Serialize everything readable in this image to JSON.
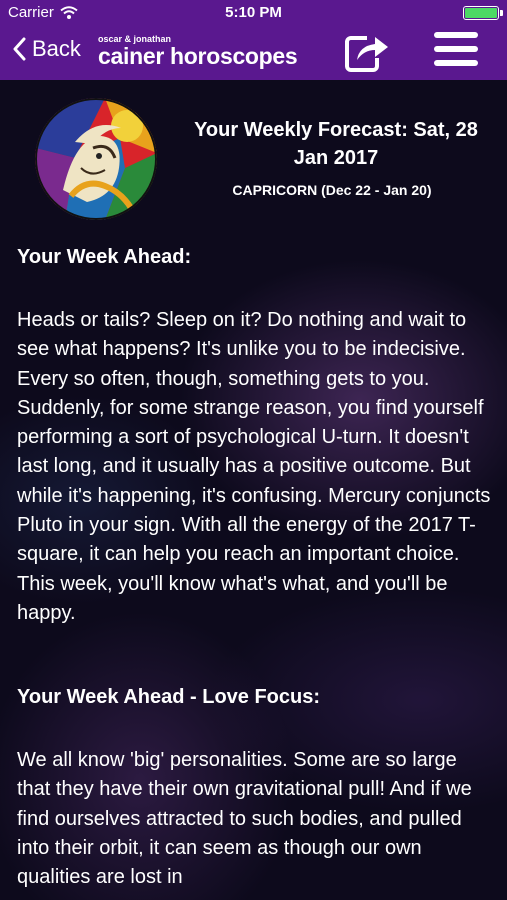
{
  "status_bar": {
    "carrier": "Carrier",
    "time": "5:10 PM"
  },
  "nav": {
    "back_label": "Back",
    "brand_small": "oscar & jonathan",
    "brand_big": "cainer horoscopes"
  },
  "forecast": {
    "title": "Your Weekly Forecast: Sat, 28 Jan 2017",
    "sign": "CAPRICORN (Dec 22 - Jan 20)"
  },
  "sections": [
    {
      "heading": "Your Week Ahead:",
      "body": "Heads or tails? Sleep on it? Do nothing and wait to see what happens? It's unlike you to be indecisive. Every so often, though, something gets to you. Suddenly, for some strange reason, you find yourself performing a sort of psychological U-turn. It doesn't last long, and it usually has a positive outcome. But while it's happening, it's confusing. Mercury conjuncts Pluto in your sign. With all the energy of the 2017 T-square, it can help you reach an important choice. This week, you'll know what's what, and you'll be happy."
    },
    {
      "heading": "Your Week Ahead - Love Focus:",
      "body": "We all know 'big' personalities. Some are so large that they have their own gravitational pull! And if we find ourselves attracted to such bodies, and pulled into their orbit, it can seem as though our own qualities are lost in"
    }
  ]
}
